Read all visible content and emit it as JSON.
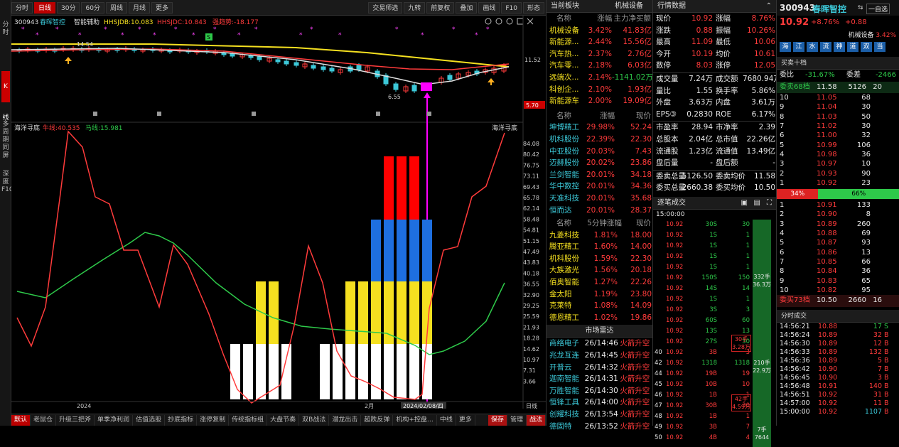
{
  "left_strip": [
    "分时",
    "K线",
    "多周期同屏",
    "深度F10"
  ],
  "topbar": {
    "left": [
      "分时",
      "日线",
      "30分",
      "60分",
      "周线",
      "月线",
      "更多"
    ],
    "right": [
      "交易师选",
      "九转",
      "前复权",
      "叠加",
      "画线",
      "F10",
      "形态"
    ]
  },
  "chart_header": {
    "code": "300943",
    "name": "春晖智控",
    "label1": "智能辅助",
    "hh1": "HHSJDB:10.083",
    "hh2": "HHSJDC:10.843",
    "qd": "强趋势:-18.177",
    "price_axis_hi": "11.52",
    "price_axis_lo": "5.70",
    "low_label": "6.55",
    "mark_145": "14.54",
    "s_label": "S"
  },
  "osc_header": {
    "name": "海洋寻底",
    "long": "牛线:40.535",
    "short": "马线:15.981",
    "right_label": "海洋寻底"
  },
  "osc_axis": [
    "84.08",
    "80.42",
    "76.75",
    "73.11",
    "69.43",
    "65.78",
    "62.14",
    "58.48",
    "54.81",
    "51.15",
    "47.49",
    "43.83",
    "40.18",
    "36.55",
    "32.90",
    "29.25",
    "25.59",
    "21.93",
    "18.28",
    "14.62",
    "10.97",
    "7.31",
    "3.66"
  ],
  "date_axis": {
    "y2024": "2024",
    "feb": "2月",
    "cursor": "2024/02/08/四",
    "right": "日线"
  },
  "bottom_tabs": [
    "默认",
    "老鼠仓",
    "升级三把斧",
    "单季净利润",
    "估值选股",
    "抄底指标",
    "涨停复制",
    "传统指标组",
    "大盘节奏",
    "双B战法",
    "潜龙出击",
    "超跌反弹",
    "机构+控盘…",
    "中线",
    "更多",
    "保存",
    "管理",
    "战法"
  ],
  "sector": {
    "title": "当前板块",
    "sector_name": "机械设备",
    "cols": [
      "名称",
      "涨幅",
      "主力净买额"
    ],
    "rows": [
      [
        "机械设备",
        "3.42%",
        "41.83亿"
      ],
      [
        "新能源...",
        "2.44%",
        "15.56亿"
      ],
      [
        "汽车热...",
        "2.37%",
        "2.76亿"
      ],
      [
        "汽车零...",
        "2.18%",
        "6.03亿"
      ],
      [
        "远端次...",
        "2.14%",
        "-1141.02万"
      ],
      [
        "科创企...",
        "2.10%",
        "1.93亿"
      ],
      [
        "新能源车",
        "2.00%",
        "19.09亿"
      ]
    ],
    "cols2": [
      "名称",
      "涨幅",
      "现价"
    ],
    "rows2": [
      [
        "坤博精工",
        "29.98%",
        "52.24"
      ],
      [
        "机科股份",
        "22.39%",
        "22.30"
      ],
      [
        "中亚股份",
        "20.03%",
        "7.43"
      ],
      [
        "迈赫股份",
        "20.02%",
        "23.86"
      ],
      [
        "兰剑智能",
        "20.01%",
        "34.18"
      ],
      [
        "华中数控",
        "20.01%",
        "34.36"
      ],
      [
        "天准科技",
        "20.01%",
        "35.68"
      ],
      [
        "恒而达",
        "20.01%",
        "28.37"
      ]
    ],
    "cols3": [
      "名称",
      "5分钟涨幅",
      "现价"
    ],
    "rows3": [
      [
        "九菱科技",
        "1.81%",
        "18.00"
      ],
      [
        "腾亚精工",
        "1.60%",
        "14.00"
      ],
      [
        "机科股份",
        "1.59%",
        "22.30"
      ],
      [
        "大族激光",
        "1.56%",
        "20.18"
      ],
      [
        "佰奥智能",
        "1.27%",
        "22.26"
      ],
      [
        "金太阳",
        "1.19%",
        "23.80"
      ],
      [
        "克莱特",
        "1.08%",
        "14.09"
      ],
      [
        "德恩精工",
        "1.02%",
        "19.86"
      ]
    ]
  },
  "radar": {
    "title": "市场雷达",
    "rows": [
      [
        "商络电子",
        "26/14:46",
        "火箭升空"
      ],
      [
        "兆龙互连",
        "26/14:45",
        "火箭升空"
      ],
      [
        "开普云",
        "26/14:32",
        "火箭升空"
      ],
      [
        "迦南智能",
        "26/14:31",
        "火箭升空"
      ],
      [
        "万胜智能",
        "26/14:30",
        "火箭升空"
      ],
      [
        "恒锋工具",
        "26/14:00",
        "火箭升空"
      ],
      [
        "创耀科技",
        "26/13:54",
        "火箭升空"
      ],
      [
        "德固特",
        "26/13:52",
        "火箭升空"
      ]
    ]
  },
  "quote": {
    "title": "行情数据",
    "rows": [
      [
        "现价",
        "10.92",
        "涨幅",
        "8.76%"
      ],
      [
        "涨跌",
        "0.88",
        "振幅",
        "10.26%"
      ],
      [
        "最高",
        "11.09",
        "最低",
        "10.06"
      ],
      [
        "今开",
        "10.19",
        "均价",
        "10.61"
      ],
      [
        "数停",
        "8.03",
        "涨停",
        "12.05"
      ]
    ],
    "rows2": [
      [
        "成交量",
        "7.24万",
        "成交额",
        "7680.94万"
      ],
      [
        "量比",
        "1.55",
        "换手率",
        "5.86%"
      ],
      [
        "外盘",
        "3.63万",
        "内盘",
        "3.61万"
      ],
      [
        "EPS③",
        "0.2830",
        "ROE",
        "6.17%"
      ]
    ],
    "rows3": [
      [
        "市盈率",
        "28.94",
        "市净率",
        "2.39"
      ],
      [
        "总股本",
        "2.04亿",
        "总市值",
        "22.26亿"
      ],
      [
        "流通股",
        "1.23亿",
        "流通值",
        "13.49亿"
      ],
      [
        "盘后量",
        "-",
        "盘后额",
        "-"
      ]
    ],
    "rows4": [
      [
        "委卖总量",
        "5126.50",
        "委卖均价",
        "11.58"
      ],
      [
        "委买总量",
        "2660.38",
        "委买均价",
        "10.50"
      ]
    ]
  },
  "ticks": {
    "title": "逐笔成交",
    "header_time": "15:00:00",
    "rows": [
      [
        "10.92",
        "30S",
        "30"
      ],
      [
        "10.92",
        "1S",
        "1"
      ],
      [
        "10.92",
        "1S",
        "1"
      ],
      [
        "10.92",
        "1S",
        "1"
      ],
      [
        "10.92",
        "1S",
        "1"
      ],
      [
        "10.92",
        "150S",
        "150"
      ],
      [
        "10.92",
        "14S",
        "14"
      ],
      [
        "10.92",
        "1S",
        "1"
      ],
      [
        "10.92",
        "3S",
        "3"
      ],
      [
        "10.92",
        "60S",
        "60"
      ],
      [
        "10.92",
        "13S",
        "13"
      ],
      [
        "10.92",
        "27S",
        "30"
      ],
      [
        "10.92",
        "3B",
        "3"
      ],
      [
        "10.92",
        "1318",
        "1318"
      ],
      [
        "10.92",
        "19B",
        "19"
      ],
      [
        "10.92",
        "10B",
        "10"
      ],
      [
        "10.92",
        "1B",
        "1"
      ],
      [
        "10.92",
        "30B",
        "30"
      ],
      [
        "10.92",
        "1B",
        "1"
      ],
      [
        "10.92",
        "3B",
        "7"
      ],
      [
        "10.92",
        "4B",
        "4"
      ]
    ],
    "idx": [
      "",
      "40",
      "42",
      "44",
      "45",
      "46",
      "47",
      "48",
      "49",
      "50"
    ],
    "big1": "332手",
    "big1b": "36.3万",
    "big2": "210手",
    "big2b": "22.9万",
    "big3": "7手",
    "big3b": "7644",
    "box1": "30手",
    "box1b": "3.28万",
    "box2": "42手",
    "box2b": "4.59万"
  },
  "ob": {
    "code": "300943",
    "name": "春晖智控",
    "price": "10.92",
    "chg": "+8.76%",
    "chg2": "+0.88",
    "self": "一自选",
    "sector": "机械设备",
    "sector_pct": "3.42%",
    "tabs": [
      "海",
      "江",
      "水",
      "流",
      "神",
      "道",
      "双",
      "当"
    ],
    "title": "买卖十档",
    "wb": "委比",
    "wbv": "-31.67%",
    "wc": "委差",
    "wcv": "-2466",
    "sell_label": "委卖68档",
    "sell_top": [
      "11.58",
      "5126",
      "20"
    ],
    "sells": [
      [
        "10",
        "11.05",
        "68"
      ],
      [
        "9",
        "11.04",
        "30"
      ],
      [
        "8",
        "11.03",
        "50"
      ],
      [
        "7",
        "11.02",
        "30"
      ],
      [
        "6",
        "11.00",
        "32"
      ],
      [
        "5",
        "10.99",
        "106"
      ],
      [
        "4",
        "10.98",
        "36"
      ],
      [
        "3",
        "10.97",
        "10"
      ],
      [
        "2",
        "10.93",
        "90"
      ],
      [
        "1",
        "10.92",
        "23"
      ]
    ],
    "ratio_l": "34%",
    "ratio_r": "66%",
    "buys": [
      [
        "1",
        "10.91",
        "133"
      ],
      [
        "2",
        "10.90",
        "8"
      ],
      [
        "3",
        "10.89",
        "260"
      ],
      [
        "4",
        "10.88",
        "69"
      ],
      [
        "5",
        "10.87",
        "93"
      ],
      [
        "6",
        "10.86",
        "13"
      ],
      [
        "7",
        "10.85",
        "66"
      ],
      [
        "8",
        "10.84",
        "36"
      ],
      [
        "9",
        "10.83",
        "65"
      ],
      [
        "10",
        "10.82",
        "95"
      ]
    ],
    "buy_label": "委买73档",
    "buy_bottom": [
      "10.50",
      "2660",
      "16"
    ],
    "trade_title": "分时成交",
    "trades": [
      [
        "14:56:21",
        "10.88",
        "17",
        "S"
      ],
      [
        "14:56:24",
        "10.89",
        "32",
        "B"
      ],
      [
        "14:56:30",
        "10.89",
        "12",
        "B"
      ],
      [
        "14:56:33",
        "10.89",
        "132",
        "B"
      ],
      [
        "14:56:36",
        "10.89",
        "5",
        "B"
      ],
      [
        "14:56:42",
        "10.90",
        "7",
        "B"
      ],
      [
        "14:56:45",
        "10.90",
        "3",
        "B"
      ],
      [
        "14:56:48",
        "10.91",
        "140",
        "B"
      ],
      [
        "14:56:51",
        "10.92",
        "31",
        "B"
      ],
      [
        "14:57:00",
        "10.92",
        "11",
        "B"
      ],
      [
        "15:00:00",
        "10.92",
        "1107",
        "B"
      ]
    ]
  }
}
